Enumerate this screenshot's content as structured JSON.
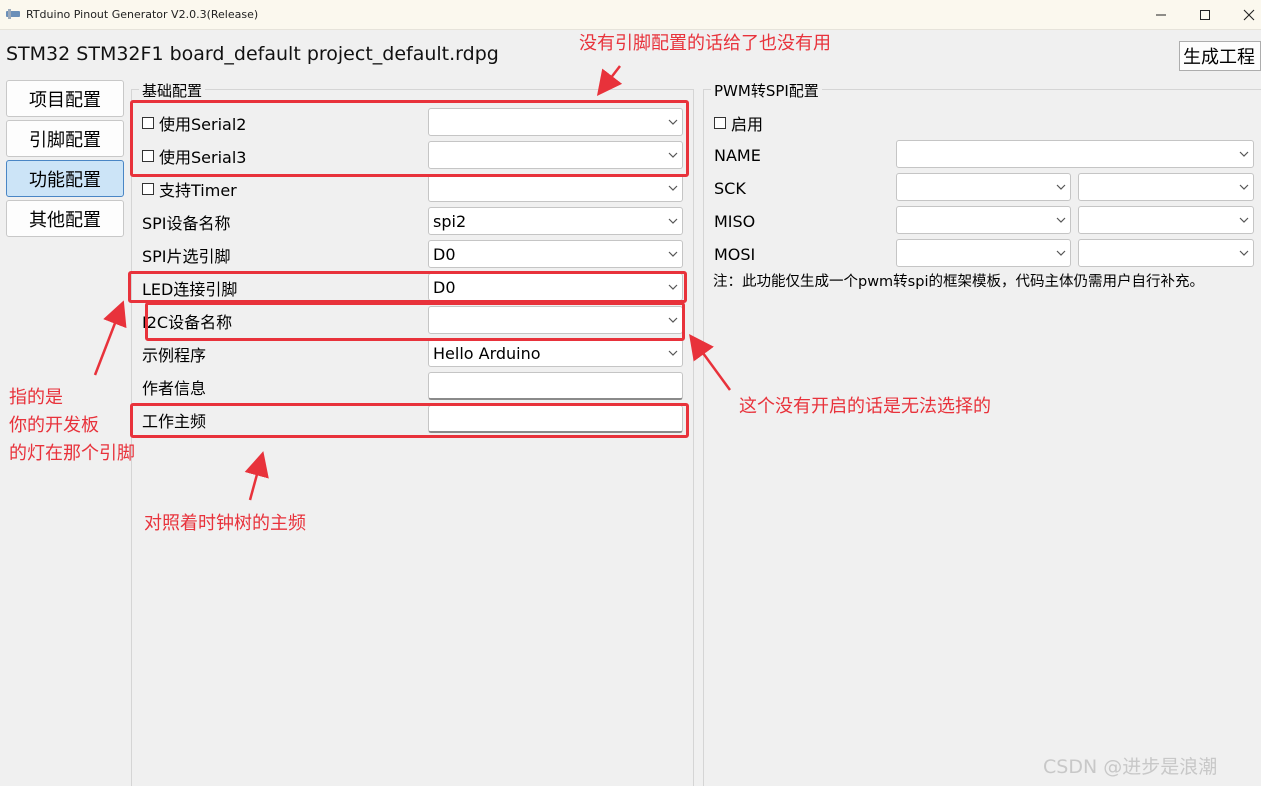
{
  "window": {
    "title": "RTduino Pinout Generator V2.0.3(Release)"
  },
  "header": {
    "project_title": "STM32 STM32F1 board_default project_default.rdpg",
    "generate_label": "生成工程"
  },
  "nav": {
    "items": [
      "项目配置",
      "引脚配置",
      "功能配置",
      "其他配置"
    ],
    "active": "功能配置"
  },
  "basic": {
    "title": "基础配置",
    "serial2_label": "使用Serial2",
    "serial2_value": "",
    "serial3_label": "使用Serial3",
    "serial3_value": "",
    "timer_label": "支持Timer",
    "timer_value": "",
    "spi_name_label": "SPI设备名称",
    "spi_name_value": "spi2",
    "spi_cs_label": "SPI片选引脚",
    "spi_cs_value": "D0",
    "led_label": "LED连接引脚",
    "led_value": "D0",
    "i2c_label": "I2C设备名称",
    "i2c_value": "",
    "example_label": "示例程序",
    "example_value": "Hello Arduino",
    "author_label": "作者信息",
    "author_value": "",
    "freq_label": "工作主频",
    "freq_value": ""
  },
  "pwm": {
    "title": "PWM转SPI配置",
    "enable_label": "启用",
    "name_label": "NAME",
    "sck_label": "SCK",
    "miso_label": "MISO",
    "mosi_label": "MOSI",
    "note": "注：此功能仅生成一个pwm转spi的框架模板，代码主体仍需用户自行补充。"
  },
  "annotations": {
    "top": "没有引脚配置的话给了也没有用",
    "left": [
      "指的是",
      "你的开发板",
      "的灯在那个引脚"
    ],
    "bottom": "对照着时钟树的主频",
    "right": "这个没有开启的话是无法选择的"
  },
  "watermark": "CSDN @进步是浪潮",
  "colors": {
    "annotation": "#e8323b",
    "active_nav": "#cce4f7"
  },
  "icons": [
    "app-icon",
    "minimize-icon",
    "maximize-icon",
    "close-icon",
    "chevron-down-icon"
  ]
}
